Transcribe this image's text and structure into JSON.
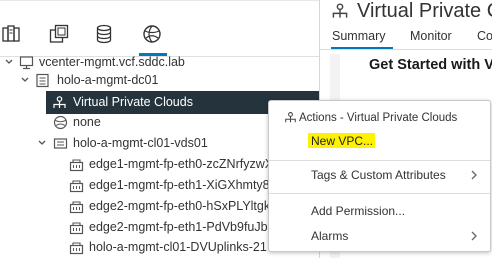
{
  "navigator": {
    "tabs": [
      {
        "name": "hosts-and-clusters",
        "icon": "hosts-clusters-icon",
        "active": false
      },
      {
        "name": "vms-and-templates",
        "icon": "vms-templates-icon",
        "active": false
      },
      {
        "name": "storage",
        "icon": "storage-icon",
        "active": false
      },
      {
        "name": "networking",
        "icon": "networking-icon",
        "active": true
      }
    ],
    "tree": [
      {
        "label": "vcenter-mgmt.vcf.sddc.lab",
        "icon": "vcenter-icon",
        "expanded": true
      },
      {
        "label": "holo-a-mgmt-dc01",
        "icon": "datacenter-icon",
        "expanded": true
      },
      {
        "label": "Virtual Private Clouds",
        "icon": "vpc-icon",
        "selected": true
      },
      {
        "label": "none",
        "icon": "network-globe-icon"
      },
      {
        "label": "holo-a-mgmt-cl01-vds01",
        "icon": "distributed-switch-icon",
        "expanded": true
      },
      {
        "label": "edge1-mgmt-fp-eth0-zcZNrfyzwX",
        "icon": "port-group-icon"
      },
      {
        "label": "edge1-mgmt-fp-eth1-XiGXhmty8H",
        "icon": "port-group-icon"
      },
      {
        "label": "edge2-mgmt-fp-eth0-hSxPLYltgk",
        "icon": "port-group-icon"
      },
      {
        "label": "edge2-mgmt-fp-eth1-PdVb9fuJbr",
        "icon": "port-group-icon"
      },
      {
        "label": "holo-a-mgmt-cl01-DVUplinks-21",
        "icon": "port-group-icon"
      }
    ]
  },
  "right_panel": {
    "title": "Virtual Private Clo",
    "title_icon": "vpc-icon",
    "tabs": [
      "Summary",
      "Monitor",
      "Co"
    ],
    "active_tab": "Summary",
    "heading": "Get Started with V"
  },
  "context_menu": {
    "header": "Actions - Virtual Private Clouds",
    "header_icon": "vpc-icon",
    "items": [
      {
        "label": "New VPC...",
        "highlighted": true
      },
      {
        "label": "Tags & Custom Attributes",
        "submenu": true
      },
      {
        "label": "Add Permission..."
      },
      {
        "label": "Alarms",
        "submenu": true
      }
    ]
  },
  "colors": {
    "selection_background": "#24333c",
    "accent": "#0079b8",
    "highlight": "#fff200"
  }
}
